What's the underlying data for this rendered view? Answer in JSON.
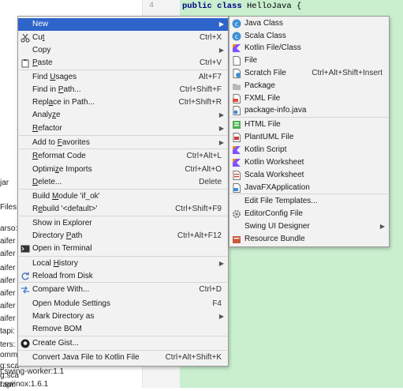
{
  "editor": {
    "line_number": "4",
    "code": {
      "kw1": "public",
      "kw2": "class",
      "name": "HelloJava",
      "brace": "{"
    }
  },
  "tree_fragments": [
    "jar",
    "Files",
    "arso:",
    "aifer",
    "aifer",
    "aifer",
    "aifer",
    "aifer",
    "aifer",
    "aifer",
    "tapi:",
    "ters:",
    "omm",
    "g:sca",
    "g:sca",
    "rapi:"
  ],
  "status_lines": [
    "t:swing-worker:1.1",
    "t:swinox:1.6.1"
  ],
  "context_menu": {
    "items": [
      {
        "label": "New",
        "shortcut": "",
        "submenu": true,
        "icon": "",
        "highlighted": true
      },
      {
        "label": "Cut",
        "underline": "t",
        "shortcut": "Ctrl+X",
        "icon": "scissors-icon"
      },
      {
        "label": "Copy",
        "underline": "",
        "shortcut": "",
        "submenu": true
      },
      {
        "label": "Paste",
        "underline": "P",
        "shortcut": "Ctrl+V",
        "icon": "clipboard-icon"
      },
      {
        "label": "Find Usages",
        "underline": "U",
        "shortcut": "Alt+F7"
      },
      {
        "label": "Find in Path...",
        "underline": "P",
        "shortcut": "Ctrl+Shift+F"
      },
      {
        "label": "Replace in Path...",
        "underline": "a",
        "shortcut": "Ctrl+Shift+R"
      },
      {
        "label": "Analyze",
        "underline": "z",
        "shortcut": "",
        "submenu": true
      },
      {
        "label": "Refactor",
        "underline": "R",
        "shortcut": "",
        "submenu": true
      },
      {
        "label": "Add to Favorites",
        "underline": "F",
        "shortcut": "",
        "submenu": true
      },
      {
        "label": "Reformat Code",
        "underline": "R",
        "shortcut": "Ctrl+Alt+L"
      },
      {
        "label": "Optimize Imports",
        "underline": "z",
        "shortcut": "Ctrl+Alt+O"
      },
      {
        "label": "Delete...",
        "underline": "D",
        "shortcut": "Delete"
      },
      {
        "label": "Build Module 'if_ok'",
        "underline": "M",
        "shortcut": ""
      },
      {
        "label": "Rebuild '<default>'",
        "underline": "e",
        "shortcut": "Ctrl+Shift+F9"
      },
      {
        "label": "Show in Explorer",
        "underline": "",
        "shortcut": ""
      },
      {
        "label": "Directory Path",
        "underline": "P",
        "shortcut": "Ctrl+Alt+F12"
      },
      {
        "label": "Open in Terminal",
        "underline": "",
        "shortcut": "",
        "icon": "terminal-icon"
      },
      {
        "label": "Local History",
        "underline": "H",
        "shortcut": "",
        "submenu": true
      },
      {
        "label": "Reload from Disk",
        "underline": "",
        "shortcut": "",
        "icon": "reload-icon"
      },
      {
        "label": "Compare With...",
        "underline": "",
        "shortcut": "Ctrl+D",
        "icon": "compare-icon"
      },
      {
        "label": "Open Module Settings",
        "underline": "",
        "shortcut": "F4"
      },
      {
        "label": "Mark Directory as",
        "underline": "",
        "shortcut": "",
        "submenu": true
      },
      {
        "label": "Remove BOM",
        "underline": "",
        "shortcut": ""
      },
      {
        "label": "Create Gist...",
        "underline": "",
        "shortcut": "",
        "icon": "github-icon"
      },
      {
        "label": "Convert Java File to Kotlin File",
        "underline": "",
        "shortcut": "Ctrl+Alt+Shift+K"
      }
    ]
  },
  "new_submenu": {
    "items": [
      {
        "label": "Java Class",
        "icon": "java-class-icon"
      },
      {
        "label": "Scala Class",
        "icon": "scala-class-icon"
      },
      {
        "label": "Kotlin File/Class",
        "icon": "kotlin-file-icon"
      },
      {
        "label": "File",
        "icon": "file-icon"
      },
      {
        "label": "Scratch File",
        "shortcut": "Ctrl+Alt+Shift+Insert",
        "icon": "scratch-file-icon"
      },
      {
        "label": "Package",
        "icon": "package-icon"
      },
      {
        "label": "FXML File",
        "icon": "fxml-file-icon"
      },
      {
        "label": "package-info.java",
        "icon": "package-info-icon"
      },
      {
        "label": "HTML File",
        "icon": "html-file-icon"
      },
      {
        "label": "PlantUML File",
        "icon": "plantuml-file-icon"
      },
      {
        "label": "Kotlin Script",
        "icon": "kotlin-script-icon"
      },
      {
        "label": "Kotlin Worksheet",
        "icon": "kotlin-worksheet-icon"
      },
      {
        "label": "Scala Worksheet",
        "icon": "scala-worksheet-icon"
      },
      {
        "label": "JavaFXApplication",
        "icon": "javafx-application-icon"
      },
      {
        "label": "Edit File Templates...",
        "icon": ""
      },
      {
        "label": "EditorConfig File",
        "icon": "gear-icon"
      },
      {
        "label": "Swing UI Designer",
        "icon": "",
        "submenu": true
      },
      {
        "label": "Resource Bundle",
        "icon": "resource-bundle-icon"
      }
    ]
  },
  "colors": {
    "highlight": "#2f65ca",
    "menu_bg": "#f2f2f2",
    "editor_bg": "#c9efcf"
  }
}
